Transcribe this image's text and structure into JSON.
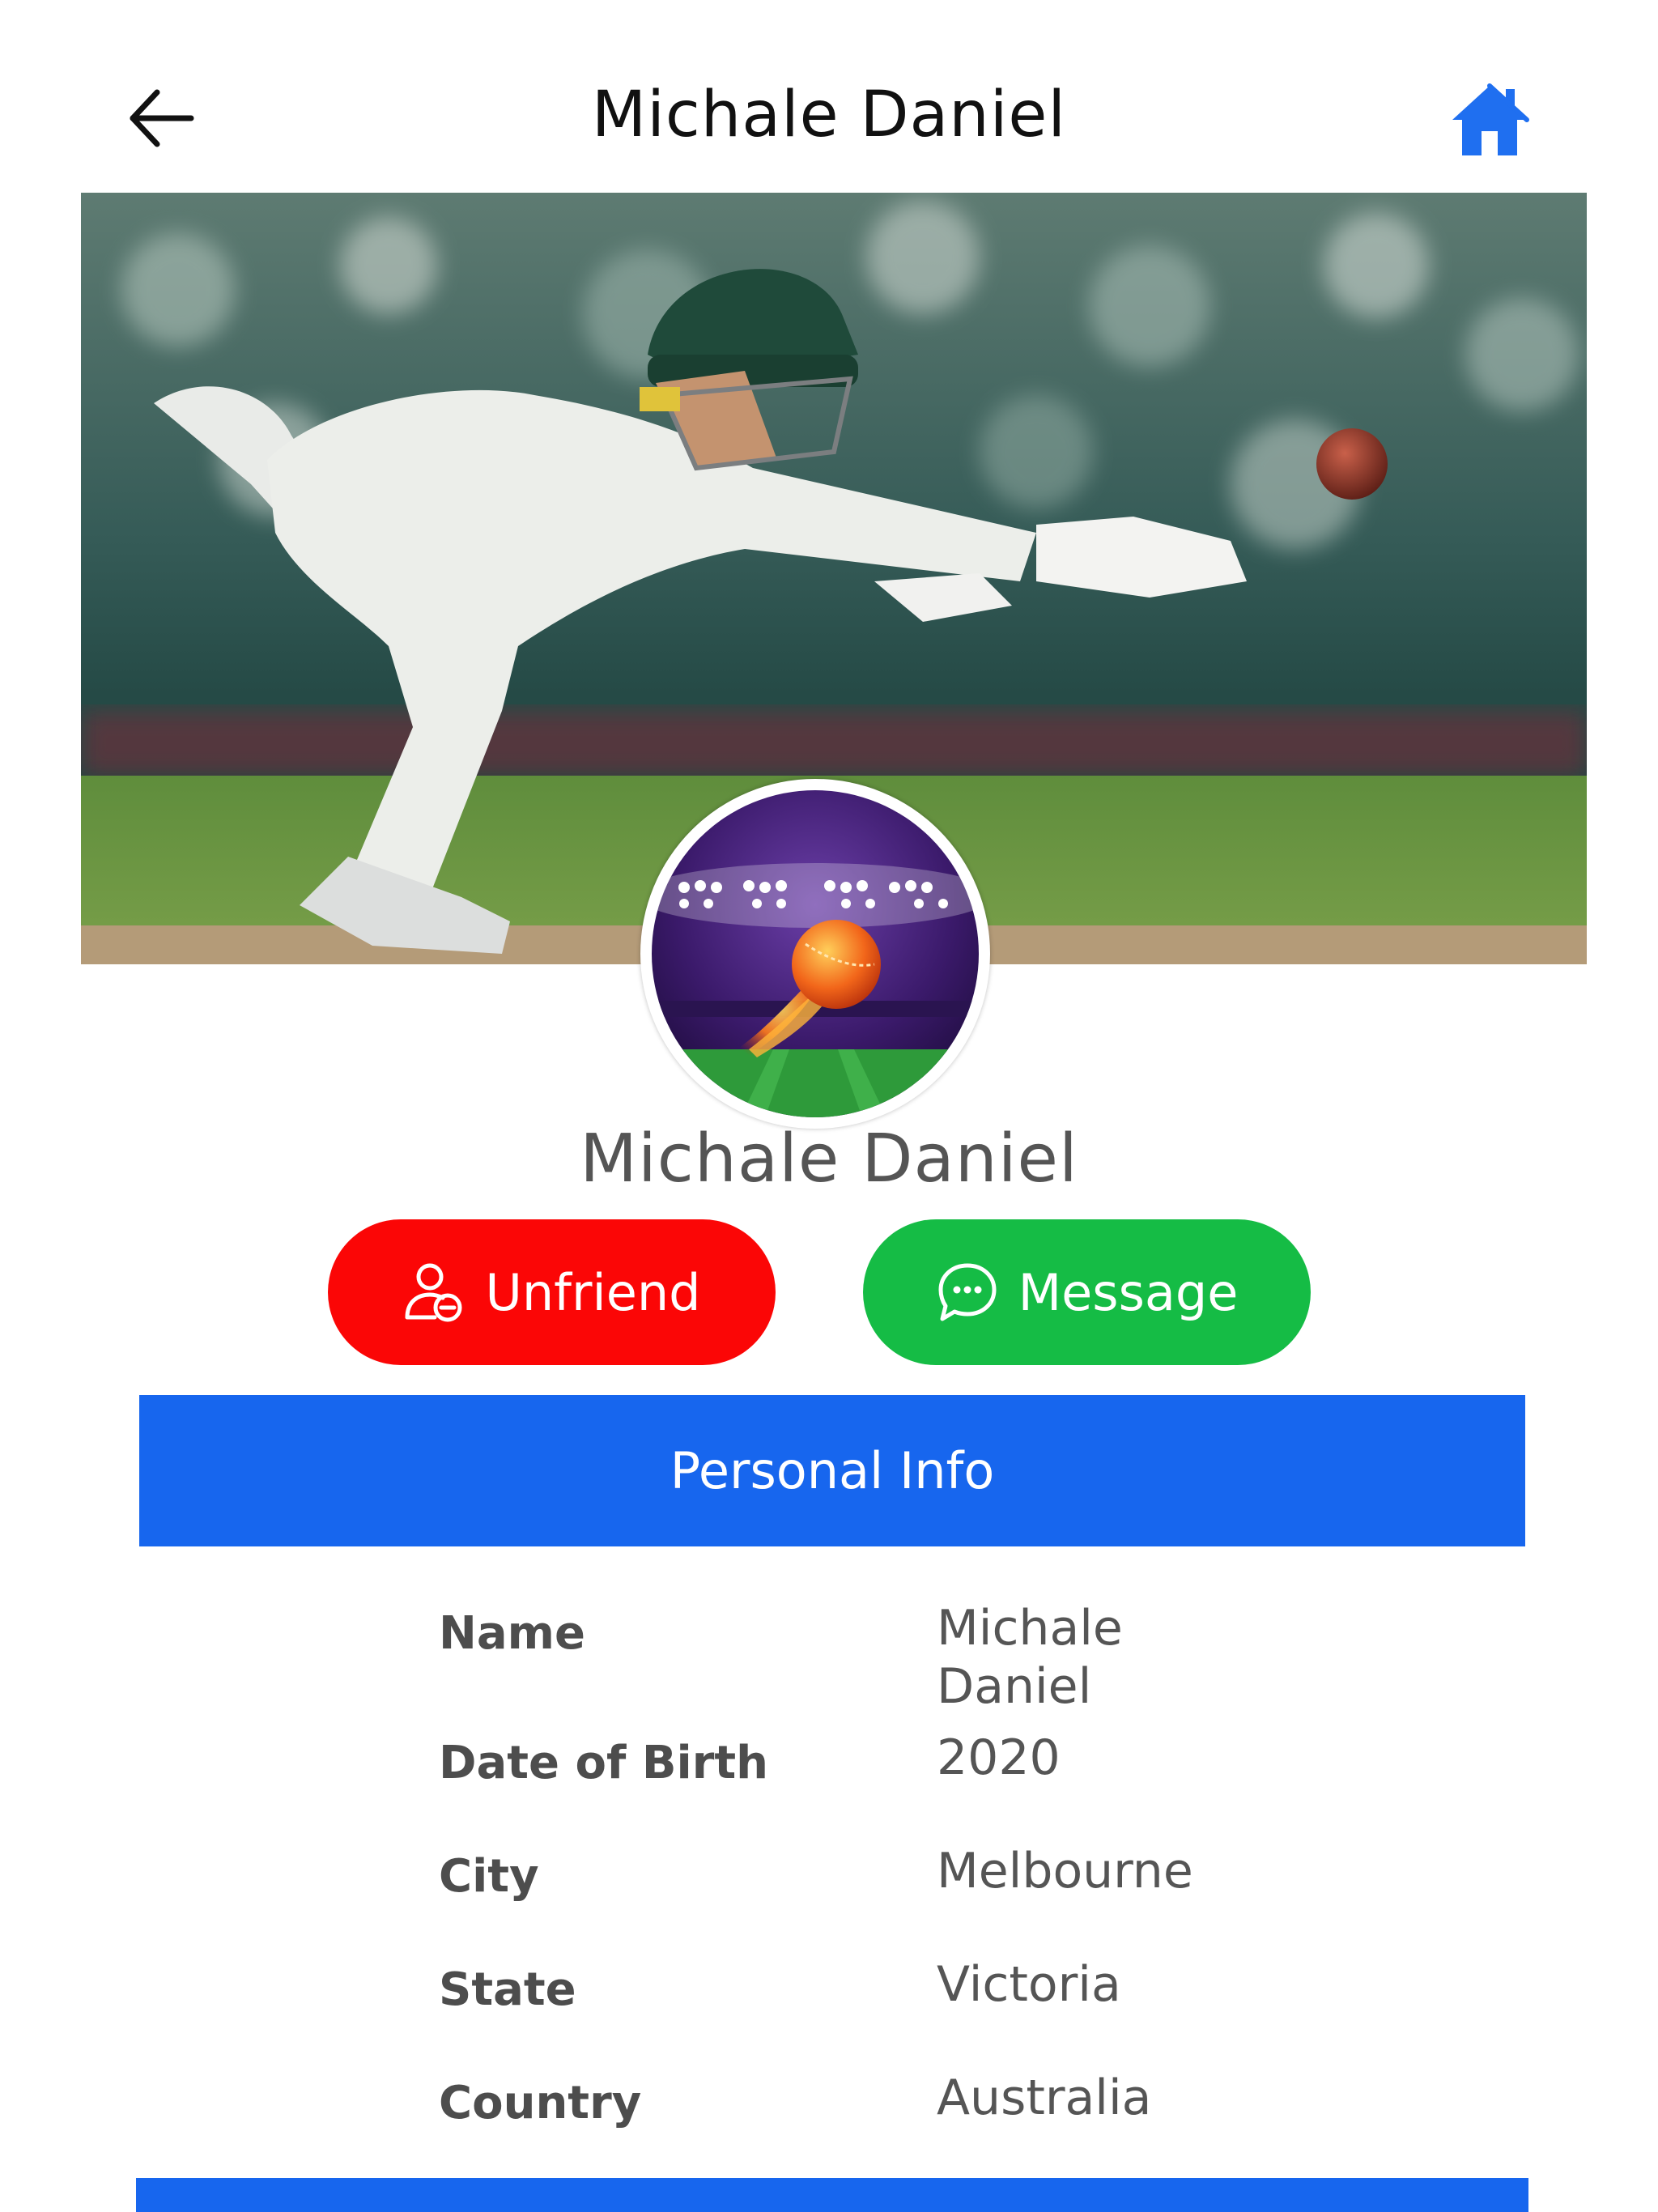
{
  "header": {
    "title": "Michale Daniel"
  },
  "profile": {
    "name": "Michale Daniel"
  },
  "actions": {
    "unfriend_label": "Unfriend",
    "message_label": "Message"
  },
  "personal_info": {
    "header": "Personal Info",
    "rows": [
      {
        "label": "Name",
        "value": "Michale Daniel"
      },
      {
        "label": "Date of Birth",
        "value": "2020"
      },
      {
        "label": "City",
        "value": "Melbourne"
      },
      {
        "label": "State",
        "value": "Victoria"
      },
      {
        "label": "Country",
        "value": "Australia"
      }
    ]
  },
  "icons": {
    "back": "arrow-left-icon",
    "home": "home-icon",
    "unfriend": "user-minus-icon",
    "message": "chat-bubble-icon"
  },
  "colors": {
    "accent_blue": "#1766ee",
    "unfriend_red": "#fb0606",
    "message_green": "#15bc45",
    "home_icon_blue": "#1f6ff0"
  }
}
